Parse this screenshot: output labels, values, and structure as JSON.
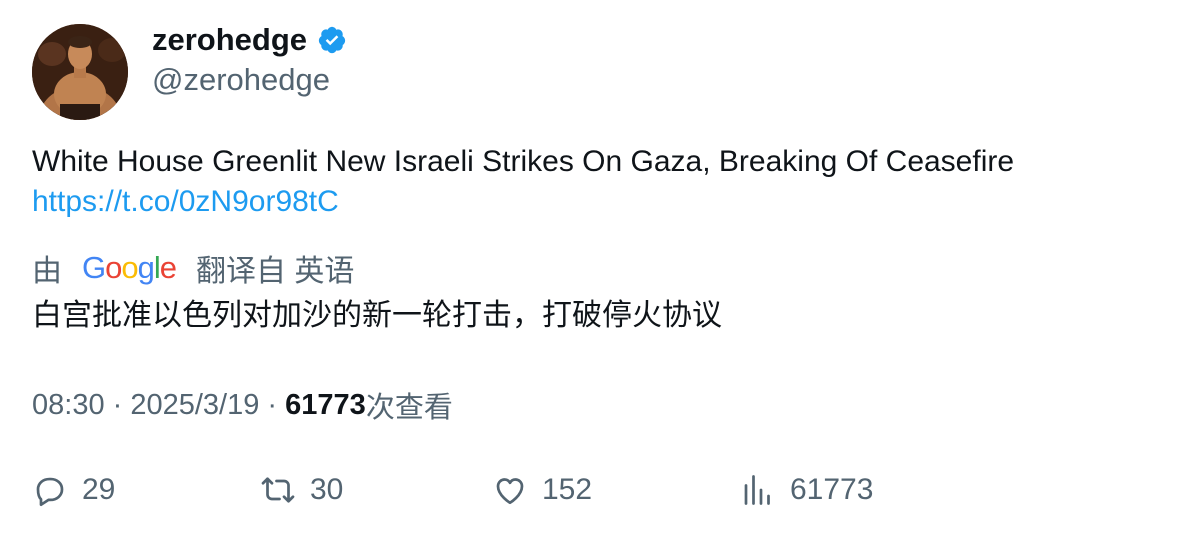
{
  "author": {
    "display_name": "zerohedge",
    "handle": "@zerohedge",
    "verified": true
  },
  "tweet": {
    "text": "White House Greenlit New Israeli Strikes On Gaza, Breaking Of Ceasefire",
    "link": "https://t.co/0zN9or98tC"
  },
  "translation": {
    "prefix": "由",
    "provider": "Google",
    "suffix": "翻译自 英语",
    "text": "白宫批准以色列对加沙的新一轮打击，打破停火协议"
  },
  "meta": {
    "time": "08:30",
    "separator": " · ",
    "date": "2025/3/19",
    "views": "61773",
    "views_label": "次查看"
  },
  "actions": {
    "replies": "29",
    "retweets": "30",
    "likes": "152",
    "views": "61773"
  },
  "colors": {
    "accent": "#1d9bf0",
    "muted": "#536471",
    "text": "#0f1419"
  }
}
